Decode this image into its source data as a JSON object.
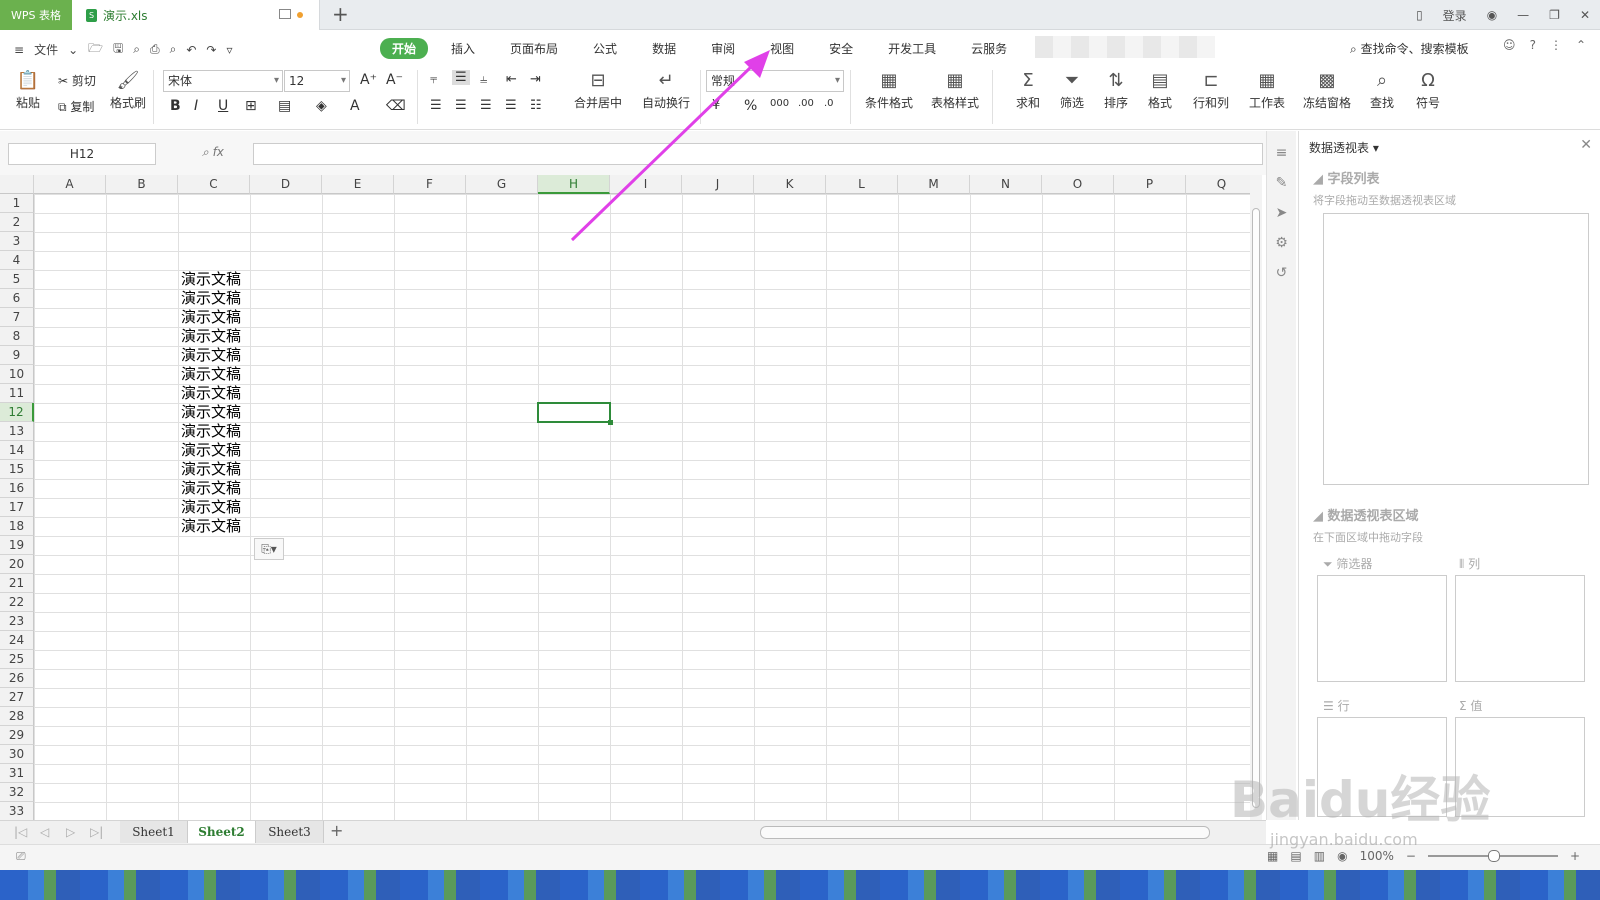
{
  "titlebar": {
    "app_tab": "WPS 表格",
    "file_tab": "演示.xls",
    "new_tab": "+",
    "login": "登录"
  },
  "menubar": {
    "file": "文件",
    "tabs": [
      "开始",
      "插入",
      "页面布局",
      "公式",
      "数据",
      "审阅",
      "视图",
      "安全",
      "开发工具",
      "云服务"
    ],
    "active_tab": "开始",
    "search_cmd": "查找命令、搜索模板"
  },
  "toolbar": {
    "paste": "粘贴",
    "cut": "剪切",
    "copy": "复制",
    "format_painter": "格式刷",
    "font_name": "宋体",
    "font_size": "12",
    "merge_center": "合并居中",
    "auto_wrap": "自动换行",
    "number_format": "常规",
    "cond_format": "条件格式",
    "table_style": "表格样式",
    "sum": "求和",
    "filter": "筛选",
    "sort": "排序",
    "format": "格式",
    "row_col": "行和列",
    "worksheet": "工作表",
    "freeze": "冻结窗格",
    "find": "查找",
    "symbol": "符号"
  },
  "formula_bar": {
    "name_box": "H12",
    "fx": "fx",
    "value": ""
  },
  "grid": {
    "columns": [
      "A",
      "B",
      "C",
      "D",
      "E",
      "F",
      "G",
      "H",
      "I",
      "J",
      "K",
      "L",
      "M",
      "N",
      "O",
      "P",
      "Q"
    ],
    "selected_column": "H",
    "rows": [
      "1",
      "2",
      "3",
      "4",
      "5",
      "6",
      "7",
      "8",
      "9",
      "10",
      "11",
      "12",
      "13",
      "14",
      "15",
      "16",
      "17",
      "18",
      "19",
      "20",
      "21",
      "22",
      "23",
      "24",
      "25",
      "26",
      "27",
      "28",
      "29",
      "30",
      "31",
      "32",
      "33"
    ],
    "selected_row": "12",
    "cell_text": "演示文稿",
    "filled_rows": [
      "5",
      "6",
      "7",
      "8",
      "9",
      "10",
      "11",
      "12",
      "13",
      "14",
      "15",
      "16",
      "17",
      "18"
    ],
    "filled_column": "C"
  },
  "pivot_panel": {
    "title": "数据透视表",
    "field_list": "字段列表",
    "field_hint": "将字段拖动至数据透视表区域",
    "area_title": "数据透视表区域",
    "area_hint": "在下面区域中拖动字段",
    "filter": "筛选器",
    "column": "列",
    "row": "行",
    "value": "值"
  },
  "sheets": {
    "tabs": [
      "Sheet1",
      "Sheet2",
      "Sheet3"
    ],
    "active": "Sheet2",
    "add": "+"
  },
  "status": {
    "zoom": "100%"
  },
  "watermark": {
    "text": "Baidu经验",
    "url": "jingyan.baidu.com"
  },
  "colors": {
    "accent": "#4caf50",
    "arrow": "#e040e8"
  }
}
